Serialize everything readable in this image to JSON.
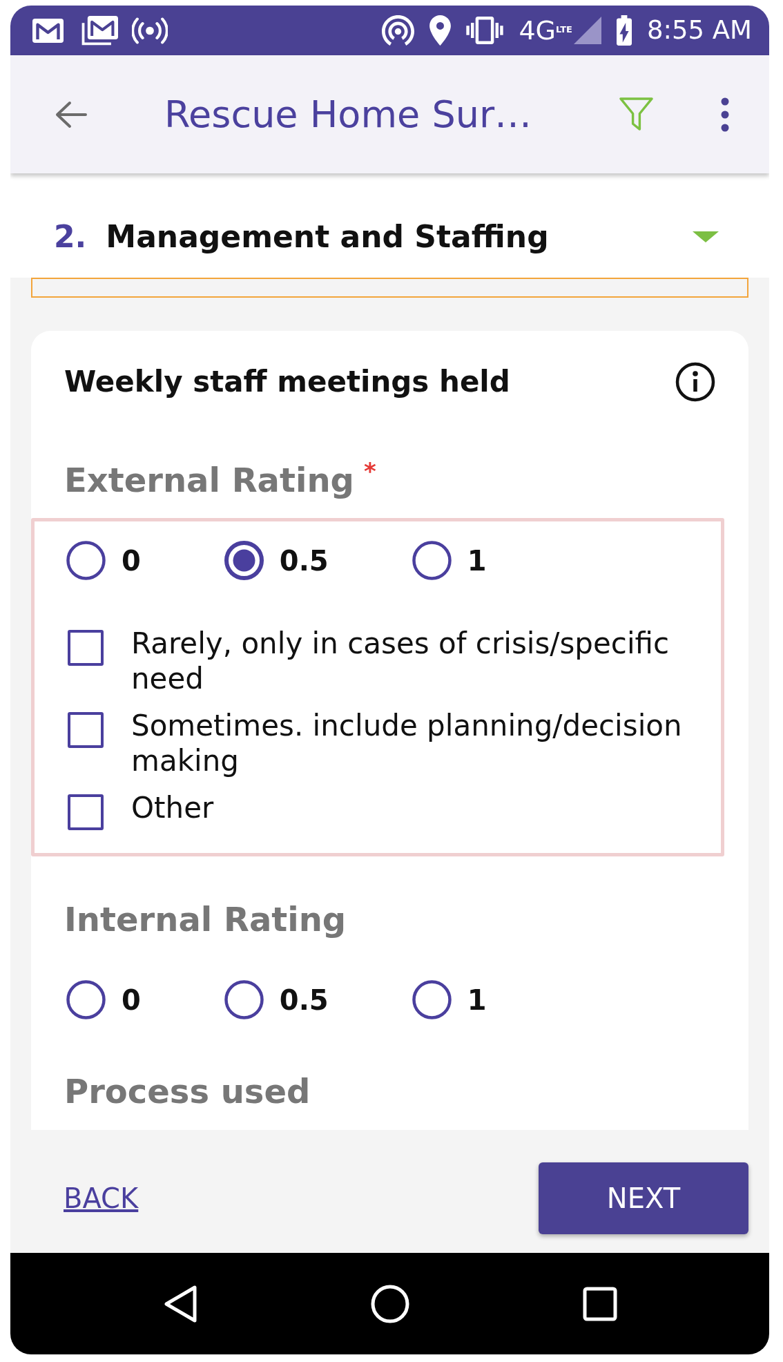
{
  "status_bar": {
    "network": "4G",
    "network_badge": "LTE",
    "time": "8:55 AM"
  },
  "app_bar": {
    "title": "Rescue Home Sur…"
  },
  "section": {
    "number": "2.",
    "title": "Management and Staffing"
  },
  "question": {
    "title": "Weekly staff meetings held",
    "fields": [
      {
        "kind": "rating",
        "label": "External Rating",
        "required_mark": "*",
        "invalid": true,
        "options": [
          {
            "label": "0",
            "selected": false
          },
          {
            "label": "0.5",
            "selected": true
          },
          {
            "label": "1",
            "selected": false
          }
        ],
        "choices": [
          {
            "label": "Rarely, only in cases of crisis/specific need",
            "checked": false
          },
          {
            "label": "Sometimes. include planning/decision making",
            "checked": false
          },
          {
            "label": "Other",
            "checked": false
          }
        ]
      },
      {
        "kind": "rating",
        "label": "Internal Rating",
        "invalid": false,
        "options": [
          {
            "label": "0",
            "selected": false
          },
          {
            "label": "0.5",
            "selected": false
          },
          {
            "label": "1",
            "selected": false
          }
        ]
      },
      {
        "kind": "heading",
        "label": "Process used"
      }
    ]
  },
  "footer": {
    "back": "BACK",
    "next": "NEXT"
  }
}
